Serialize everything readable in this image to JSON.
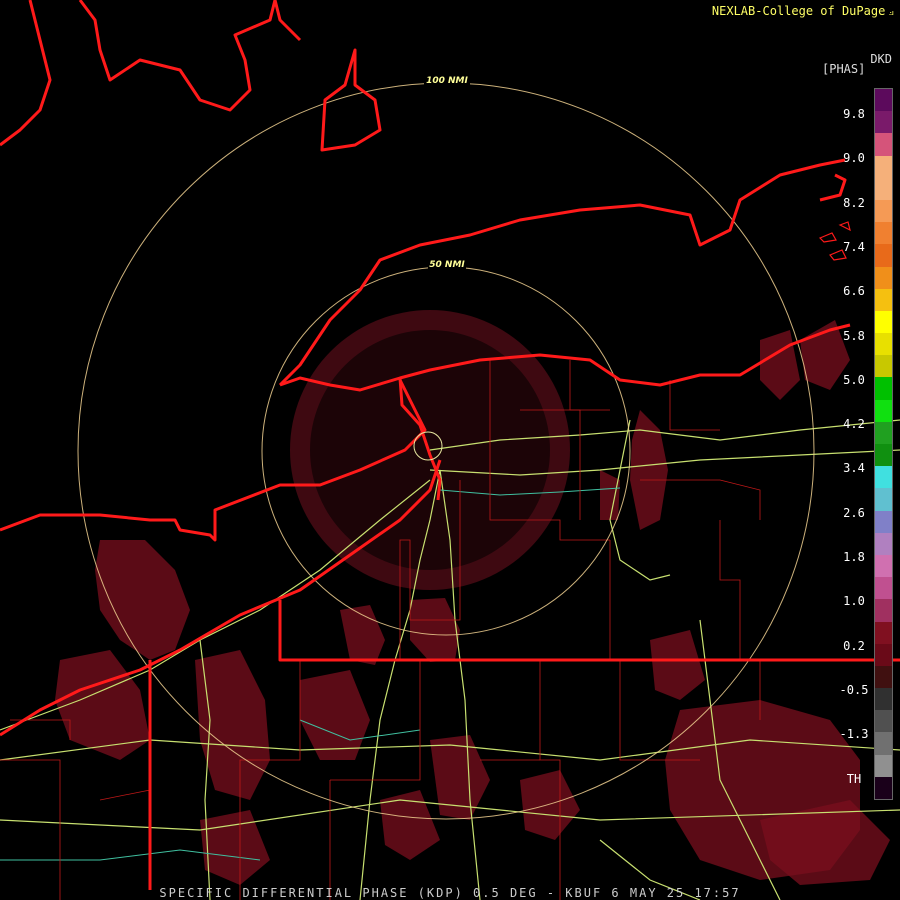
{
  "header": {
    "credit": "NEXLAB-College of DuPage"
  },
  "legend": {
    "product_code": "DKD",
    "unit": "[PHAS]",
    "ticks": [
      "9.8",
      "9.0",
      "8.2",
      "7.4",
      "6.6",
      "5.8",
      "5.0",
      "4.2",
      "3.4",
      "2.6",
      "1.8",
      "1.0",
      "0.2",
      "-0.5",
      "-1.3",
      "TH"
    ],
    "colors": [
      "#5c0a5c",
      "#7a1a6a",
      "#d5547a",
      "#f5b07a",
      "#f5b07a",
      "#f59a55",
      "#f08030",
      "#e86a1a",
      "#f08f1a",
      "#f5c010",
      "#ffff00",
      "#e8e000",
      "#c8c800",
      "#00c000",
      "#10e010",
      "#20a020",
      "#109010",
      "#40e0e0",
      "#60c0d0",
      "#8080c8",
      "#b080c0",
      "#d070b0",
      "#c05090",
      "#a03060",
      "#801020",
      "#6a0a18",
      "#401010",
      "#303030",
      "#505050",
      "#707070",
      "#909090",
      "#1a001a"
    ]
  },
  "range_rings": [
    "50 NMI",
    "100 NMI"
  ],
  "footer": {
    "caption": "SPECIFIC DIFFERENTIAL PHASE (KDP) 0.5 DEG - KBUF 6 MAY 25 17:57"
  }
}
